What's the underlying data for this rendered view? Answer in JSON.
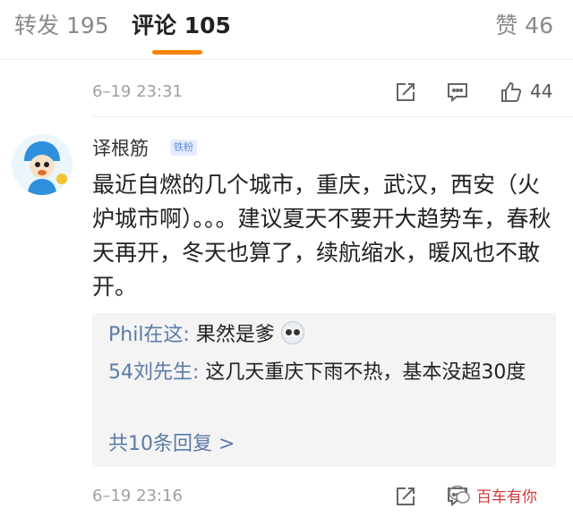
{
  "tabs": {
    "repost": "转发 195",
    "comment": "评论 105",
    "like": "赞 46"
  },
  "top_meta": {
    "time": "6–19 23:31",
    "like_count": "44"
  },
  "comment": {
    "username": "译根筋",
    "badge": "铁粉",
    "text": "最近自燃的几个城市，重庆，武汉，西安（火炉城市啊）。。。建议夏天不要开大趋势车，春秋天再开，冬天也算了，续航缩水，暖风也不敢开。",
    "replies": [
      {
        "name": "Phil在这:",
        "text": " 果然是爹"
      },
      {
        "name": "54刘先生:",
        "text": " 这几天重庆下雨不热，基本没超30度"
      }
    ],
    "more": "共10条回复 >"
  },
  "bottom_meta": {
    "time": "6–19 23:16"
  },
  "watermark": "百车有你",
  "icons": {
    "share": "share-icon",
    "comment": "comment-icon",
    "like": "thumbs-up-icon"
  },
  "colors": {
    "accent": "#ff8200",
    "link": "#5b7ba8"
  }
}
